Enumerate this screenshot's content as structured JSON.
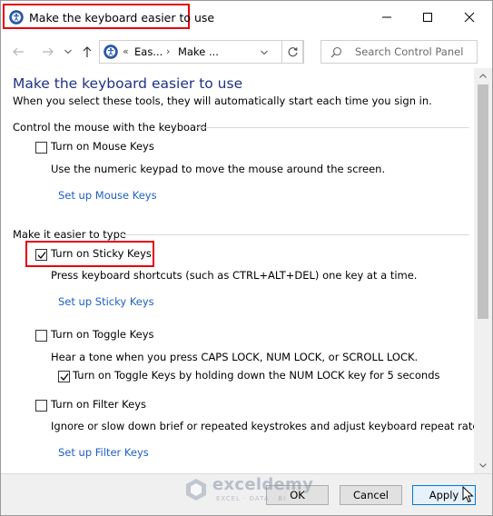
{
  "window": {
    "title": "Make the keyboard easier to use"
  },
  "address": {
    "breadcrumb_separator": "«",
    "crumb1": "Eas...",
    "crumb2": "Make ...",
    "arrow": "›",
    "search_placeholder": "Search Control Panel"
  },
  "content": {
    "title": "Make the keyboard easier to use",
    "subtitle": "When you select these tools, they will automatically start each time you sign in.",
    "mouse_section": {
      "heading": "Control the mouse with the keyboard",
      "mouse_keys_label": "Turn on Mouse Keys",
      "mouse_keys_checked": false,
      "mouse_keys_desc": "Use the numeric keypad to move the mouse around the screen.",
      "mouse_keys_link": "Set up Mouse Keys"
    },
    "type_section": {
      "heading": "Make it easier to type",
      "sticky_label": "Turn on Sticky Keys",
      "sticky_checked": true,
      "sticky_desc": "Press keyboard shortcuts (such as CTRL+ALT+DEL) one key at a time.",
      "sticky_link": "Set up Sticky Keys",
      "toggle_label": "Turn on Toggle Keys",
      "toggle_checked": false,
      "toggle_desc": "Hear a tone when you press CAPS LOCK, NUM LOCK, or SCROLL LOCK.",
      "toggle_hold_label": "Turn on Toggle Keys by holding down the NUM LOCK key for 5 seconds",
      "toggle_hold_checked": true,
      "filter_label": "Turn on Filter Keys",
      "filter_checked": false,
      "filter_desc": "Ignore or slow down brief or repeated keystrokes and adjust keyboard repeat rates.",
      "filter_link": "Set up Filter Keys"
    }
  },
  "footer": {
    "ok": "OK",
    "cancel": "Cancel",
    "apply": "Apply"
  },
  "watermark": {
    "name": "exceldemy",
    "tagline": "EXCEL · DATA · BI"
  },
  "colors": {
    "highlight": "#e3000f",
    "link": "#1e5fc6",
    "title": "#1e3287"
  }
}
